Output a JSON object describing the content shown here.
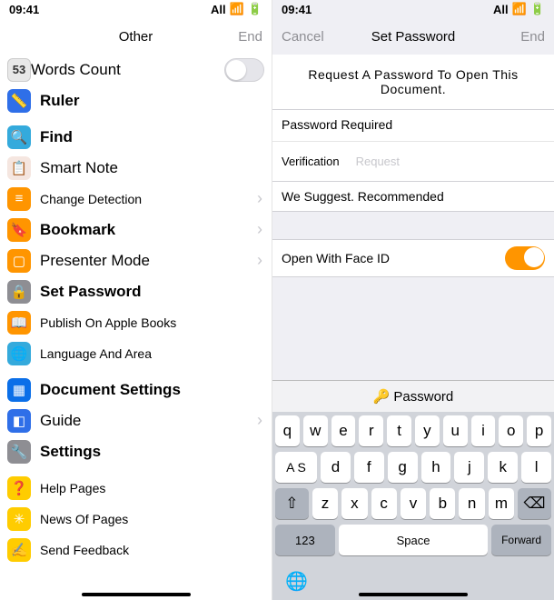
{
  "left": {
    "status": {
      "time": "09:41",
      "carrier": "All"
    },
    "nav": {
      "title": "Other",
      "right": "End"
    },
    "items": [
      {
        "icon_bg": "#ffffff",
        "icon_txt": "53",
        "label": "Words Count",
        "bold": false,
        "badge53": true,
        "toggle": "off"
      },
      {
        "icon_bg": "#2f6fe8",
        "icon_txt": "📏",
        "label": "Ruler",
        "bold": true
      },
      {
        "gap": true
      },
      {
        "icon_bg": "#34aadc",
        "icon_txt": "🔍",
        "label": "Find",
        "bold": true
      },
      {
        "icon_bg": "#f5e6e0",
        "icon_txt": "📋",
        "label": "Smart Note",
        "bold": false
      },
      {
        "icon_bg": "#ff9500",
        "icon_txt": "≡",
        "label": "Change Detection",
        "bold": false,
        "chev": true,
        "small": true
      },
      {
        "icon_bg": "#ff9500",
        "icon_txt": "🔖",
        "label": "Bookmark",
        "bold": true,
        "chev": true
      },
      {
        "icon_bg": "#ff9500",
        "icon_txt": "▢",
        "label": "Presenter Mode",
        "bold": false,
        "chev": true
      },
      {
        "icon_bg": "#8e8e93",
        "icon_txt": "🔒",
        "label": "Set Password",
        "bold": true
      },
      {
        "icon_bg": "#ff9500",
        "icon_txt": "📖",
        "label": "Publish On Apple Books",
        "bold": false,
        "small": true
      },
      {
        "icon_bg": "#34aadc",
        "icon_txt": "🌐",
        "label": "Language And Area",
        "bold": false,
        "small": true
      },
      {
        "gap": true
      },
      {
        "icon_bg": "#0b6fe8",
        "icon_txt": "▦",
        "label": "Document Settings",
        "bold": true
      },
      {
        "icon_bg": "#2f6fe8",
        "icon_txt": "◧",
        "label": "Guide",
        "bold": false,
        "chev": true
      },
      {
        "icon_bg": "#8e8e93",
        "icon_txt": "🔧",
        "label": "Settings",
        "bold": true
      },
      {
        "gap": true
      },
      {
        "icon_bg": "#ffcc00",
        "icon_txt": "❓",
        "label": "Help Pages",
        "bold": false,
        "small": true
      },
      {
        "icon_bg": "#ffcc00",
        "icon_txt": "✳",
        "label": "News Of Pages",
        "bold": false,
        "small": true
      },
      {
        "icon_bg": "#ffcc00",
        "icon_txt": "✍",
        "label": "Send Feedback",
        "bold": false,
        "small": true
      }
    ]
  },
  "right": {
    "status": {
      "time": "09:41",
      "carrier": "All"
    },
    "nav": {
      "left": "Cancel",
      "title": "Set Password",
      "right": "End"
    },
    "banner": "Request A Password To Open This Document.",
    "field_label": "Password Required",
    "verify_label": "Verification",
    "verify_ph": "Request",
    "suggest": "We Suggest. Recommended",
    "faceid_label": "Open With Face ID",
    "kbd": {
      "pw_label": "Password",
      "row1": [
        "q",
        "w",
        "e",
        "r",
        "t",
        "y",
        "u",
        "i",
        "o",
        "p"
      ],
      "row2": [
        "A S",
        "d",
        "f",
        "g",
        "h",
        "j",
        "k",
        "l"
      ],
      "row3_shift": "⇧",
      "row3": [
        "z",
        "x",
        "c",
        "v",
        "b",
        "n",
        "m"
      ],
      "row3_del": "⌫",
      "num": "123",
      "space": "Space",
      "fwd": "Forward"
    }
  }
}
